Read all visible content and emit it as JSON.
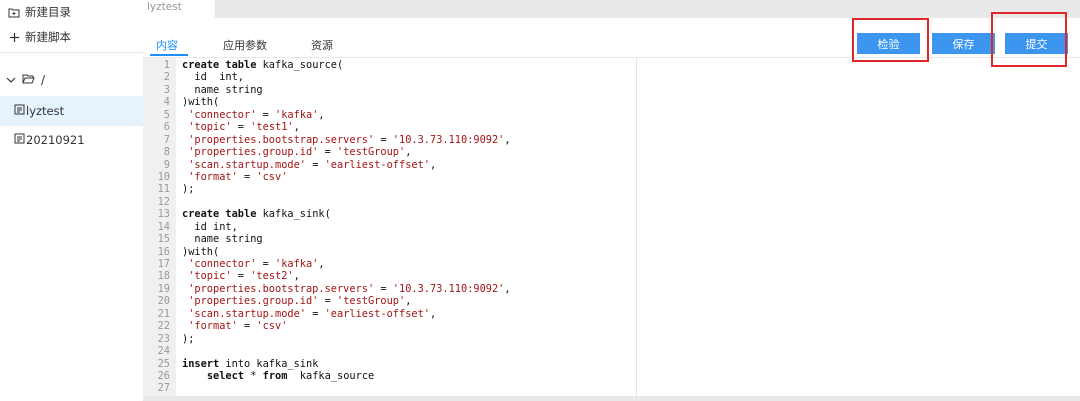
{
  "sidebar": {
    "new_dir_label": "新建目录",
    "new_script_label": "新建脚本",
    "tree_root_label": "/",
    "items": [
      {
        "label": "lyztest",
        "active": true
      },
      {
        "label": "20210921",
        "active": false
      }
    ]
  },
  "file_tab": {
    "label": "lyztest"
  },
  "subtabs": [
    {
      "label": "内容",
      "active": true
    },
    {
      "label": "应用参数",
      "active": false
    },
    {
      "label": "资源",
      "active": false
    }
  ],
  "actions": {
    "check_label": "检验",
    "save_label": "保存",
    "submit_label": "提交"
  },
  "colors": {
    "accent": "#1890ff",
    "button": "#3c95ee",
    "highlight": "#e0252b"
  },
  "editor": {
    "lines": [
      [
        {
          "t": "create table",
          "c": "kw"
        },
        {
          "t": " kafka_source(",
          "c": ""
        }
      ],
      [
        {
          "t": "  id  int,",
          "c": ""
        }
      ],
      [
        {
          "t": "  name string",
          "c": ""
        }
      ],
      [
        {
          "t": ")with(",
          "c": ""
        }
      ],
      [
        {
          "t": " 'connector'",
          "c": "str"
        },
        {
          "t": " = ",
          "c": ""
        },
        {
          "t": "'kafka'",
          "c": "str"
        },
        {
          "t": ",",
          "c": ""
        }
      ],
      [
        {
          "t": " 'topic'",
          "c": "str"
        },
        {
          "t": " = ",
          "c": ""
        },
        {
          "t": "'test1'",
          "c": "str"
        },
        {
          "t": ",",
          "c": ""
        }
      ],
      [
        {
          "t": " 'properties.bootstrap.servers'",
          "c": "str"
        },
        {
          "t": " = ",
          "c": ""
        },
        {
          "t": "'10.3.73.110:9092'",
          "c": "str"
        },
        {
          "t": ",",
          "c": ""
        }
      ],
      [
        {
          "t": " 'properties.group.id'",
          "c": "str"
        },
        {
          "t": " = ",
          "c": ""
        },
        {
          "t": "'testGroup'",
          "c": "str"
        },
        {
          "t": ",",
          "c": ""
        }
      ],
      [
        {
          "t": " 'scan.startup.mode'",
          "c": "str"
        },
        {
          "t": " = ",
          "c": ""
        },
        {
          "t": "'earliest-offset'",
          "c": "str"
        },
        {
          "t": ",",
          "c": ""
        }
      ],
      [
        {
          "t": " 'format'",
          "c": "str"
        },
        {
          "t": " = ",
          "c": ""
        },
        {
          "t": "'csv'",
          "c": "str"
        }
      ],
      [
        {
          "t": ");",
          "c": ""
        }
      ],
      [],
      [
        {
          "t": "create table",
          "c": "kw"
        },
        {
          "t": " kafka_sink(",
          "c": ""
        }
      ],
      [
        {
          "t": "  id int,",
          "c": ""
        }
      ],
      [
        {
          "t": "  name string",
          "c": ""
        }
      ],
      [
        {
          "t": ")with(",
          "c": ""
        }
      ],
      [
        {
          "t": " 'connector'",
          "c": "str"
        },
        {
          "t": " = ",
          "c": ""
        },
        {
          "t": "'kafka'",
          "c": "str"
        },
        {
          "t": ",",
          "c": ""
        }
      ],
      [
        {
          "t": " 'topic'",
          "c": "str"
        },
        {
          "t": " = ",
          "c": ""
        },
        {
          "t": "'test2'",
          "c": "str"
        },
        {
          "t": ",",
          "c": ""
        }
      ],
      [
        {
          "t": " 'properties.bootstrap.servers'",
          "c": "str"
        },
        {
          "t": " = ",
          "c": ""
        },
        {
          "t": "'10.3.73.110:9092'",
          "c": "str"
        },
        {
          "t": ",",
          "c": ""
        }
      ],
      [
        {
          "t": " 'properties.group.id'",
          "c": "str"
        },
        {
          "t": " = ",
          "c": ""
        },
        {
          "t": "'testGroup'",
          "c": "str"
        },
        {
          "t": ",",
          "c": ""
        }
      ],
      [
        {
          "t": " 'scan.startup.mode'",
          "c": "str"
        },
        {
          "t": " = ",
          "c": ""
        },
        {
          "t": "'earliest-offset'",
          "c": "str"
        },
        {
          "t": ",",
          "c": ""
        }
      ],
      [
        {
          "t": " 'format'",
          "c": "str"
        },
        {
          "t": " = ",
          "c": ""
        },
        {
          "t": "'csv'",
          "c": "str"
        }
      ],
      [
        {
          "t": ");",
          "c": ""
        }
      ],
      [],
      [
        {
          "t": "insert",
          "c": "kw"
        },
        {
          "t": " into kafka_sink",
          "c": ""
        }
      ],
      [
        {
          "t": "    ",
          "c": ""
        },
        {
          "t": "select",
          "c": "kw"
        },
        {
          "t": " * ",
          "c": ""
        },
        {
          "t": "from",
          "c": "kw"
        },
        {
          "t": "  kafka_source",
          "c": ""
        }
      ],
      []
    ]
  }
}
